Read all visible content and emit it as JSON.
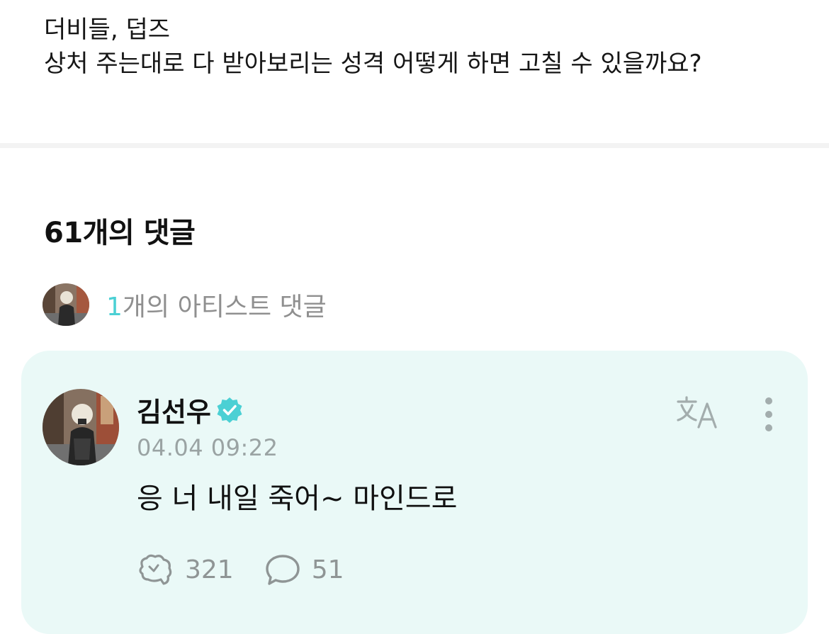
{
  "post": {
    "lines": [
      "더비들, 덥즈",
      "상처 주는대로 다 받아보리는 성격 어떻게 하면 고칠 수 있을까요?"
    ]
  },
  "comments_section": {
    "title": "61개의 댓글",
    "artist_comments": {
      "count": "1",
      "label": "개의 아티스트 댓글"
    }
  },
  "artist_comment": {
    "author": "김선우",
    "verified": true,
    "timestamp": "04.04 09:22",
    "text": "응 너 내일 죽어~ 마인드로",
    "likes": "321",
    "replies": "51"
  },
  "icons": {
    "verified": "verified-badge-icon",
    "translate": "translate-icon",
    "more": "more-vertical-icon",
    "like": "like-icon",
    "reply": "comment-bubble-icon"
  },
  "colors": {
    "accent": "#4bd0d4",
    "card_background": "#eaf9f7",
    "muted_text": "#8f8f8f"
  }
}
